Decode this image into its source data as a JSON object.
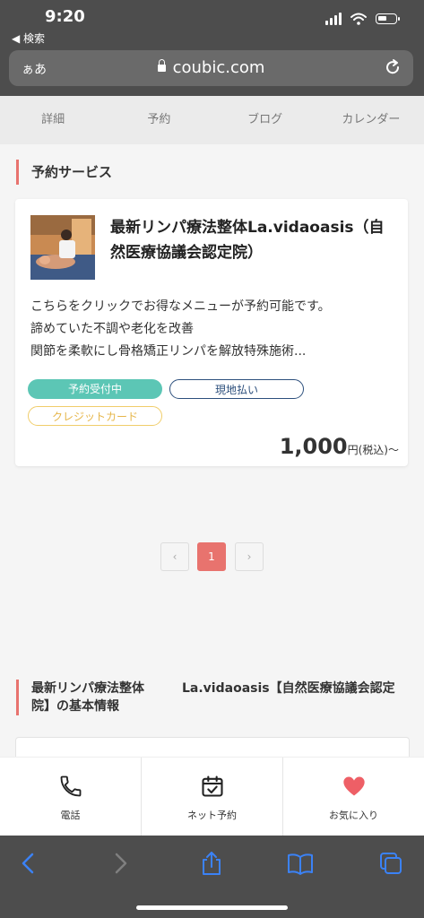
{
  "status": {
    "time": "9:20",
    "back_label": "◀ 検索"
  },
  "browser": {
    "aa_label": "ぁあ",
    "url": "coubic.com"
  },
  "tabs": [
    {
      "label": "詳細"
    },
    {
      "label": "予約"
    },
    {
      "label": "ブログ"
    },
    {
      "label": "カレンダー"
    }
  ],
  "services": {
    "heading": "予約サービス",
    "card": {
      "title": "最新リンパ療法整体La.vidaoasis（自然医療協議会認定院）",
      "description": [
        "こちらをクリックでお得なメニューが予約可能です。",
        "諦めていた不調や老化を改善",
        "関節を柔軟にし骨格矯正リンパを解放特殊施術..."
      ],
      "tags": [
        "予約受付中",
        "現地払い",
        "クレジットカード"
      ],
      "price_amount": "1,000",
      "price_unit": "円(税込)〜"
    }
  },
  "pagination": {
    "prev": "‹",
    "current": "1",
    "next": "›"
  },
  "basic_info": {
    "heading": "最新リンパ療法整体　　　La.vidaoasis【自然医療協議会認定院】の基本情報"
  },
  "actions": [
    {
      "label": "電話",
      "icon": "phone-icon"
    },
    {
      "label": "ネット予約",
      "icon": "calendar-check-icon"
    },
    {
      "label": "お気に入り",
      "icon": "heart-icon"
    }
  ],
  "colors": {
    "accent": "#e8736e",
    "teal": "#5cc6b5",
    "navy": "#2c4f7c",
    "gold": "#f0cd6a",
    "ios_bar": "#4d4d4d",
    "ios_blue": "#3b82f6"
  }
}
